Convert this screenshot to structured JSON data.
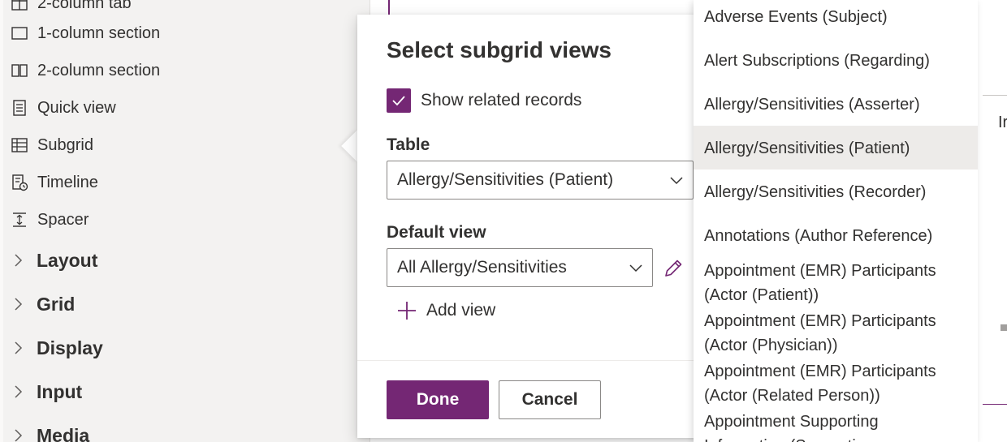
{
  "left_panel": {
    "items": [
      {
        "label": "2-column tab",
        "icon": "tab-icon"
      },
      {
        "label": "1-column section",
        "icon": "one-column-section-icon"
      },
      {
        "label": "2-column section",
        "icon": "two-column-section-icon"
      },
      {
        "label": "Quick view",
        "icon": "quick-view-icon"
      },
      {
        "label": "Subgrid",
        "icon": "subgrid-icon"
      },
      {
        "label": "Timeline",
        "icon": "timeline-icon"
      },
      {
        "label": "Spacer",
        "icon": "spacer-icon"
      }
    ],
    "groups": [
      {
        "label": "Layout"
      },
      {
        "label": "Grid"
      },
      {
        "label": "Display"
      },
      {
        "label": "Input"
      },
      {
        "label": "Media"
      }
    ]
  },
  "dialog": {
    "title": "Select subgrid views",
    "show_related_label": "Show related records",
    "show_related_checked": true,
    "table_label": "Table",
    "table_value": "Allergy/Sensitivities (Patient)",
    "default_view_label": "Default view",
    "default_view_value": "All Allergy/Sensitivities",
    "add_view_label": "Add view",
    "done_label": "Done",
    "cancel_label": "Cancel"
  },
  "dropdown": {
    "selected_index": 3,
    "options": [
      {
        "label": "Adverse Events (Subject)"
      },
      {
        "label": "Alert Subscriptions (Regarding)"
      },
      {
        "label": "Allergy/Sensitivities (Asserter)"
      },
      {
        "label": "Allergy/Sensitivities (Patient)"
      },
      {
        "label": "Allergy/Sensitivities (Recorder)"
      },
      {
        "label": "Annotations (Author Reference)"
      },
      {
        "label": "Appointment (EMR) Participants (Actor (Patient))"
      },
      {
        "label": "Appointment (EMR) Participants (Actor (Physician))"
      },
      {
        "label": "Appointment (EMR) Participants (Actor (Related Person))"
      },
      {
        "label": "Appointment Supporting Information (Supporting"
      }
    ]
  },
  "right_hint": "Ir",
  "colors": {
    "accent": "#742774",
    "panel_bg": "#f3f2f1",
    "text": "#323130",
    "selected_bg": "#edebe9"
  }
}
